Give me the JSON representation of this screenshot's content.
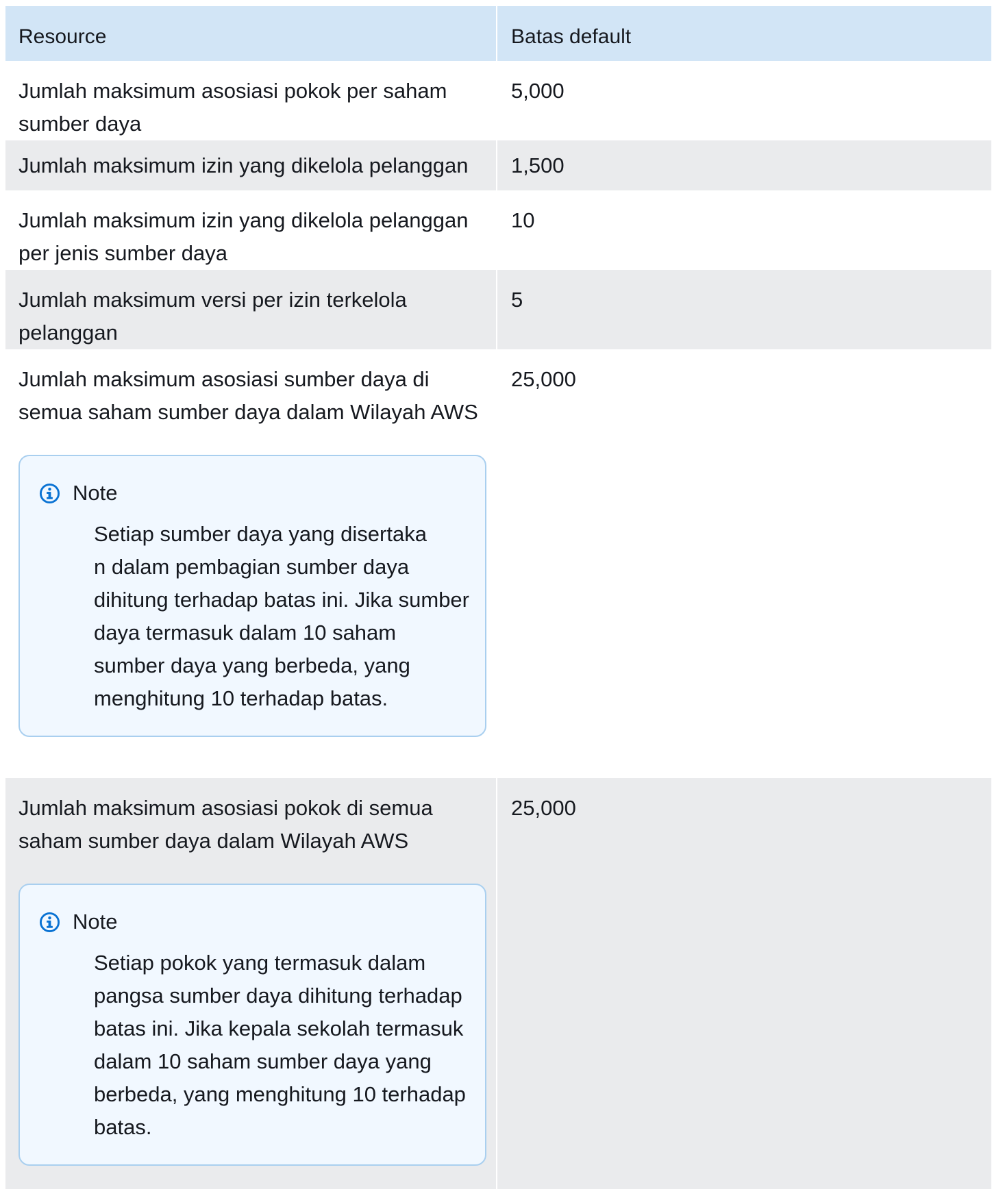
{
  "table": {
    "headers": {
      "resource": "Resource",
      "default_limit": "Batas default"
    },
    "rows": [
      {
        "resource": "Jumlah maksimum asosiasi pokok per saham sumber daya",
        "limit": "5,000"
      },
      {
        "resource": "Jumlah maksimum izin yang dikelola pelanggan",
        "limit": "1,500"
      },
      {
        "resource": "Jumlah maksimum izin yang dikelola pelanggan per jenis sumber daya",
        "limit": "10"
      },
      {
        "resource": "Jumlah maksimum versi per izin terkelola pelanggan",
        "limit": "5"
      },
      {
        "resource": "Jumlah maksimum asosiasi sumber daya di semua saham sumber daya dalam Wilayah AWS",
        "limit": "25,000",
        "note": {
          "title": "Note",
          "lines": [
            "Setiap sumber daya yang disertaka",
            "n dalam pembagian sumber daya",
            "dihitung terhadap batas ini. Jika sumber",
            "daya termasuk dalam 10 saham",
            "sumber daya yang berbeda, yang",
            "menghitung 10 terhadap batas."
          ]
        }
      },
      {
        "resource": "Jumlah maksimum asosiasi pokok di semua saham sumber daya dalam Wilayah AWS",
        "limit": "25,000",
        "note": {
          "title": "Note",
          "lines": [
            "Setiap pokok yang termasuk dalam",
            "pangsa sumber daya dihitung terhadap",
            "batas ini. Jika kepala sekolah termasuk",
            "dalam 10 saham sumber daya yang",
            "berbeda, yang menghitung 10 terhadap",
            "batas."
          ]
        }
      }
    ]
  },
  "colors": {
    "header_bg": "#d2e5f6",
    "stripe_bg": "#eaebed",
    "note_bg": "#f1f8ff",
    "note_border": "#a9cfef",
    "info_icon": "#0972d3"
  },
  "icons": {
    "note": "info-circle-icon"
  }
}
